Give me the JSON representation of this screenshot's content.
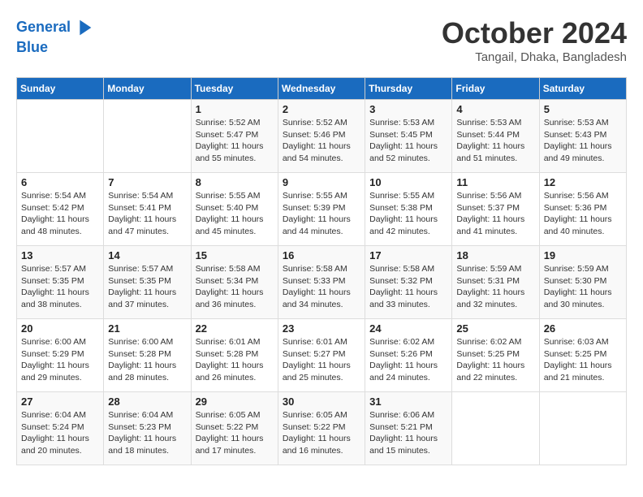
{
  "header": {
    "logo_line1": "General",
    "logo_line2": "Blue",
    "month_title": "October 2024",
    "location": "Tangail, Dhaka, Bangladesh"
  },
  "weekdays": [
    "Sunday",
    "Monday",
    "Tuesday",
    "Wednesday",
    "Thursday",
    "Friday",
    "Saturday"
  ],
  "weeks": [
    [
      {
        "day": "",
        "info": ""
      },
      {
        "day": "",
        "info": ""
      },
      {
        "day": "1",
        "info": "Sunrise: 5:52 AM\nSunset: 5:47 PM\nDaylight: 11 hours and 55 minutes."
      },
      {
        "day": "2",
        "info": "Sunrise: 5:52 AM\nSunset: 5:46 PM\nDaylight: 11 hours and 54 minutes."
      },
      {
        "day": "3",
        "info": "Sunrise: 5:53 AM\nSunset: 5:45 PM\nDaylight: 11 hours and 52 minutes."
      },
      {
        "day": "4",
        "info": "Sunrise: 5:53 AM\nSunset: 5:44 PM\nDaylight: 11 hours and 51 minutes."
      },
      {
        "day": "5",
        "info": "Sunrise: 5:53 AM\nSunset: 5:43 PM\nDaylight: 11 hours and 49 minutes."
      }
    ],
    [
      {
        "day": "6",
        "info": "Sunrise: 5:54 AM\nSunset: 5:42 PM\nDaylight: 11 hours and 48 minutes."
      },
      {
        "day": "7",
        "info": "Sunrise: 5:54 AM\nSunset: 5:41 PM\nDaylight: 11 hours and 47 minutes."
      },
      {
        "day": "8",
        "info": "Sunrise: 5:55 AM\nSunset: 5:40 PM\nDaylight: 11 hours and 45 minutes."
      },
      {
        "day": "9",
        "info": "Sunrise: 5:55 AM\nSunset: 5:39 PM\nDaylight: 11 hours and 44 minutes."
      },
      {
        "day": "10",
        "info": "Sunrise: 5:55 AM\nSunset: 5:38 PM\nDaylight: 11 hours and 42 minutes."
      },
      {
        "day": "11",
        "info": "Sunrise: 5:56 AM\nSunset: 5:37 PM\nDaylight: 11 hours and 41 minutes."
      },
      {
        "day": "12",
        "info": "Sunrise: 5:56 AM\nSunset: 5:36 PM\nDaylight: 11 hours and 40 minutes."
      }
    ],
    [
      {
        "day": "13",
        "info": "Sunrise: 5:57 AM\nSunset: 5:35 PM\nDaylight: 11 hours and 38 minutes."
      },
      {
        "day": "14",
        "info": "Sunrise: 5:57 AM\nSunset: 5:35 PM\nDaylight: 11 hours and 37 minutes."
      },
      {
        "day": "15",
        "info": "Sunrise: 5:58 AM\nSunset: 5:34 PM\nDaylight: 11 hours and 36 minutes."
      },
      {
        "day": "16",
        "info": "Sunrise: 5:58 AM\nSunset: 5:33 PM\nDaylight: 11 hours and 34 minutes."
      },
      {
        "day": "17",
        "info": "Sunrise: 5:58 AM\nSunset: 5:32 PM\nDaylight: 11 hours and 33 minutes."
      },
      {
        "day": "18",
        "info": "Sunrise: 5:59 AM\nSunset: 5:31 PM\nDaylight: 11 hours and 32 minutes."
      },
      {
        "day": "19",
        "info": "Sunrise: 5:59 AM\nSunset: 5:30 PM\nDaylight: 11 hours and 30 minutes."
      }
    ],
    [
      {
        "day": "20",
        "info": "Sunrise: 6:00 AM\nSunset: 5:29 PM\nDaylight: 11 hours and 29 minutes."
      },
      {
        "day": "21",
        "info": "Sunrise: 6:00 AM\nSunset: 5:28 PM\nDaylight: 11 hours and 28 minutes."
      },
      {
        "day": "22",
        "info": "Sunrise: 6:01 AM\nSunset: 5:28 PM\nDaylight: 11 hours and 26 minutes."
      },
      {
        "day": "23",
        "info": "Sunrise: 6:01 AM\nSunset: 5:27 PM\nDaylight: 11 hours and 25 minutes."
      },
      {
        "day": "24",
        "info": "Sunrise: 6:02 AM\nSunset: 5:26 PM\nDaylight: 11 hours and 24 minutes."
      },
      {
        "day": "25",
        "info": "Sunrise: 6:02 AM\nSunset: 5:25 PM\nDaylight: 11 hours and 22 minutes."
      },
      {
        "day": "26",
        "info": "Sunrise: 6:03 AM\nSunset: 5:25 PM\nDaylight: 11 hours and 21 minutes."
      }
    ],
    [
      {
        "day": "27",
        "info": "Sunrise: 6:04 AM\nSunset: 5:24 PM\nDaylight: 11 hours and 20 minutes."
      },
      {
        "day": "28",
        "info": "Sunrise: 6:04 AM\nSunset: 5:23 PM\nDaylight: 11 hours and 18 minutes."
      },
      {
        "day": "29",
        "info": "Sunrise: 6:05 AM\nSunset: 5:22 PM\nDaylight: 11 hours and 17 minutes."
      },
      {
        "day": "30",
        "info": "Sunrise: 6:05 AM\nSunset: 5:22 PM\nDaylight: 11 hours and 16 minutes."
      },
      {
        "day": "31",
        "info": "Sunrise: 6:06 AM\nSunset: 5:21 PM\nDaylight: 11 hours and 15 minutes."
      },
      {
        "day": "",
        "info": ""
      },
      {
        "day": "",
        "info": ""
      }
    ]
  ]
}
